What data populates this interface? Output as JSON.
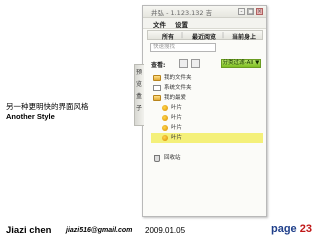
{
  "slide": {
    "heading_cn": "另一种更明快的界面风格",
    "heading_en": "Another Style",
    "footer": {
      "author": "Jiazi chen",
      "email": "jiazi516@gmail.com",
      "date": "2009.01.05",
      "page_label": "page",
      "page_number": "23"
    }
  },
  "window": {
    "title": "井弘 - 1.123.132 吉",
    "controls": [
      "-",
      "□",
      "×"
    ],
    "menu": [
      "文件",
      "设置"
    ],
    "tabs": [
      "所有",
      "最近阅览",
      "当前身上"
    ],
    "search_placeholder": "快速搜找",
    "toolbar": {
      "label": "查看:",
      "filter": "分类过滤-All ▼"
    },
    "side_tab": [
      "预",
      "览",
      "盒",
      "子"
    ],
    "tree": [
      {
        "icon": "folder-icon",
        "label": "我的文件夹"
      },
      {
        "icon": "document-icon",
        "label": "系统文件夹"
      },
      {
        "icon": "folder-icon",
        "label": "我的最爱"
      },
      {
        "icon": "leaf-icon",
        "label": "叶片"
      },
      {
        "icon": "leaf-icon",
        "label": "叶片"
      },
      {
        "icon": "leaf-icon",
        "label": "叶片"
      },
      {
        "icon": "leaf-icon",
        "label": "叶片"
      },
      {
        "icon": "blank",
        "label": ""
      },
      {
        "icon": "trash-icon",
        "label": "回收站"
      }
    ],
    "selected_index": 6
  }
}
